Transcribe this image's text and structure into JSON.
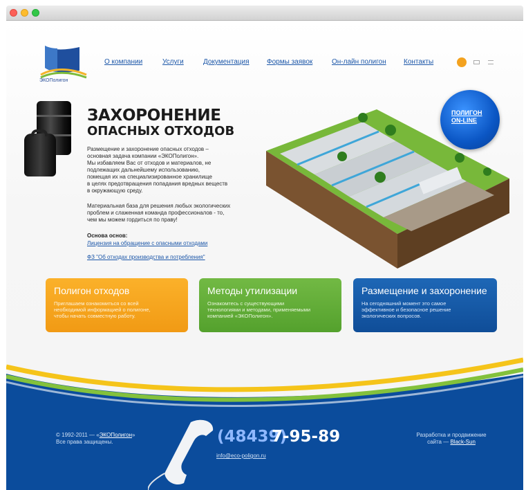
{
  "brand": {
    "logo_text": "ЭКОПолигон",
    "colors": {
      "orange": "#f19a14",
      "green": "#54a12d",
      "blue": "#0f4d98",
      "footer": "#0a4b9a"
    }
  },
  "nav": {
    "items": [
      "О компании",
      "Услуги",
      "Документация",
      "Формы заявок",
      "Он-лайн полигон",
      "Контакты"
    ]
  },
  "header_icons": [
    "home-icon",
    "mail-icon",
    "sitemap-icon"
  ],
  "hero": {
    "title_line1": "ЗАХОРОНЕНИЕ",
    "title_line2": "ОПАСНЫХ ОТХОДОВ",
    "para1_lines": [
      "Размещение и захоронение опасных отходов –",
      "основная задача компании «ЭКОПолигон».",
      "Мы избавляем Вас от отходов и материалов, не",
      "подлежащих дальнейшему использованию,",
      "помещая их на специализированное хранилище",
      "в целях предотвращения попадания вредных веществ",
      "в окружающую среду."
    ],
    "para2_lines": [
      "Материальная база для решения любых экологических",
      "проблем и слаженная команда профессионалов - то,",
      "чем мы можем гордиться по праву!"
    ],
    "basis_label": "Основа основ:",
    "link1": "Лицензия на обращение с опасными отходами",
    "link2": "ФЗ \"Об отходах производства и потребления\"",
    "online_line1": "ПОЛИГОН",
    "online_line2": "ON-LINE"
  },
  "cards": [
    {
      "title": "Полигон отходов",
      "lines": [
        "Приглашаем ознакомиться со всей",
        "необходимой информацией о полигоне,",
        "чтобы начать совместную работу."
      ]
    },
    {
      "title": "Методы утилизации",
      "lines": [
        "Ознакомтесь с существующими",
        "технологиями и методами, применяемыми",
        "компанией «ЭКОПолигон»."
      ]
    },
    {
      "title": "Размещение и захоронение",
      "lines": [
        "На сегодняшний момент это самое",
        "эффективное и безопасное решение",
        "экологических вопросов."
      ]
    }
  ],
  "footer": {
    "copyright_prefix": "© 1992-2011 — «",
    "copyright_link": "ЭКОПолигон",
    "copyright_suffix": "»",
    "rights": "Все права защищены.",
    "phone_code": "(48439)",
    "phone_number": "7-95-89",
    "email": "info@eco-poligon.ru",
    "dev_line1": "Разработка и продвижение",
    "dev_prefix": "сайта — ",
    "dev_link": "Black-Sun"
  }
}
